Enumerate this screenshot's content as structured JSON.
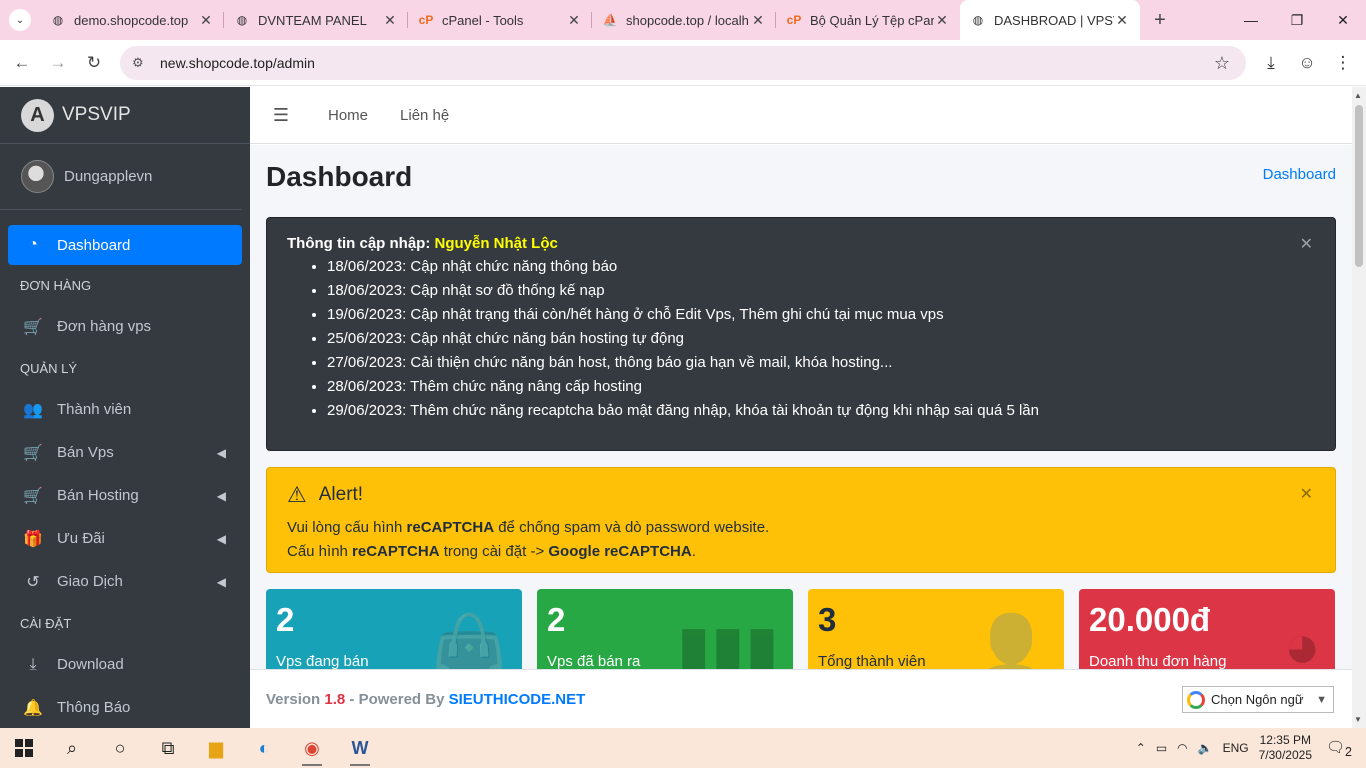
{
  "browser": {
    "tabs": [
      {
        "title": "demo.shopcode.top",
        "icon": "globe-icon"
      },
      {
        "title": "DVNTEAM PANEL",
        "icon": "globe-icon"
      },
      {
        "title": "cPanel - Tools",
        "icon": "cpanel-icon"
      },
      {
        "title": "shopcode.top / localh",
        "icon": "phpmyadmin-icon"
      },
      {
        "title": "Bộ Quản Lý Tệp cPan",
        "icon": "cpanel-icon"
      },
      {
        "title": "DASHBROAD | VPSVIP",
        "icon": "globe-icon"
      }
    ],
    "active_tab": 5,
    "url": "new.shopcode.top/admin"
  },
  "sidebar": {
    "brand": "VPSVIP",
    "user": "Dungapplevn",
    "active_item": "Dashboard",
    "headers": {
      "orders": "ĐƠN HÀNG",
      "manage": "QUẢN LÝ",
      "settings": "CÀI ĐẶT"
    },
    "items": {
      "dashboard": "Dashboard",
      "orders_vps": "Đơn hàng vps",
      "members": "Thành viên",
      "sell_vps": "Bán Vps",
      "sell_hosting": "Bán Hosting",
      "promo": "Ưu Đãi",
      "transactions": "Giao Dịch",
      "download": "Download",
      "notify": "Thông Báo"
    }
  },
  "topnav": {
    "home": "Home",
    "contact": "Liên hệ"
  },
  "page": {
    "title": "Dashboard",
    "breadcrumb": "Dashboard"
  },
  "update_info": {
    "title": "Thông tin cập nhập:",
    "author": "Nguyễn Nhật Lộc",
    "items": [
      "18/06/2023: Cập nhật chức năng thông báo",
      "18/06/2023: Cập nhật sơ đồ thống kế nạp",
      "19/06/2023: Cập nhật trạng thái còn/hết hàng ở chỗ Edit Vps, Thêm ghi chú tại mục mua vps",
      "25/06/2023: Cập nhật chức năng bán hosting tự động",
      "27/06/2023: Cải thiện chức năng bán host, thông báo gia hạn về mail, khóa hosting...",
      "28/06/2023: Thêm chức năng nâng cấp hosting",
      "29/06/2023: Thêm chức năng recaptcha bảo mật đăng nhập, khóa tài khoản tự động khi nhập sai quá 5 lần"
    ]
  },
  "alert": {
    "title": "Alert!",
    "line1_pre": "Vui lòng cấu hình ",
    "line1_bold": "reCAPTCHA",
    "line1_post": " để chống spam và dò password website.",
    "line2_pre": "Cấu hình ",
    "line2_bold1": "reCAPTCHA",
    "line2_mid": " trong cài đặt -> ",
    "line2_bold2": "Google reCAPTCHA",
    "line2_post": "."
  },
  "stats": [
    {
      "value": "2",
      "label": "Vps đang bán",
      "color": "#17a2b8",
      "icon": "shopping-bag-icon"
    },
    {
      "value": "2",
      "label": "Vps đã bán ra",
      "color": "#28a745",
      "icon": "bar-chart-icon"
    },
    {
      "value": "3",
      "label": "Tổng thành viên",
      "color": "#ffc107",
      "icon": "user-plus-icon"
    },
    {
      "value": "20.000đ",
      "label": "Doanh thu đơn hàng",
      "color": "#dc3545",
      "icon": "pie-chart-icon"
    }
  ],
  "footer": {
    "version_label": "Version",
    "version": "1.8",
    "powered": "- Powered By",
    "brand": "SIEUTHICODE.NET",
    "language_select": "Chọn Ngôn ngữ"
  },
  "taskbar": {
    "lang": "ENG",
    "time": "12:35 PM",
    "date": "7/30/2025",
    "notifications": "2"
  }
}
